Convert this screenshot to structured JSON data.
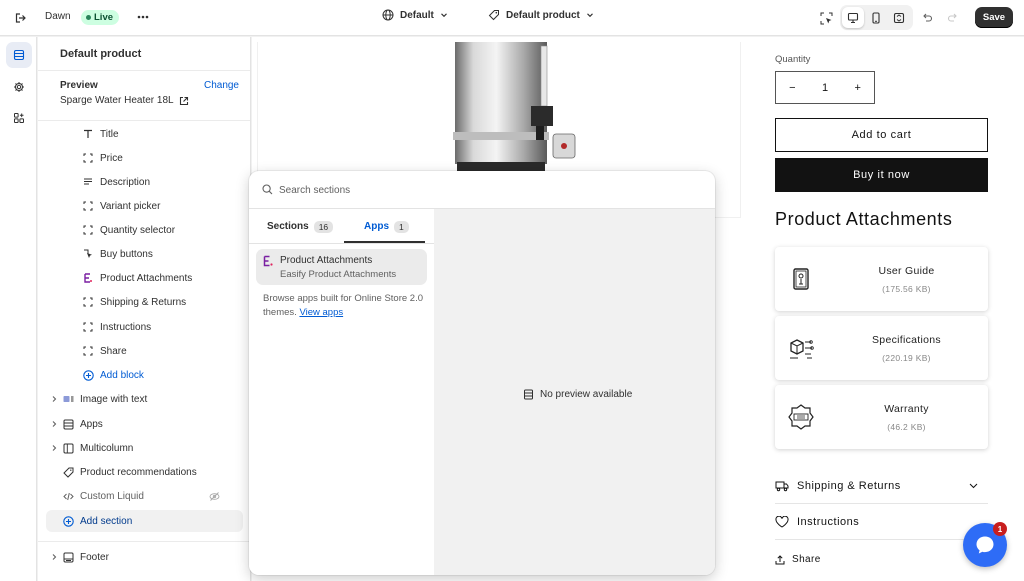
{
  "topbar": {
    "store_name": "Dawn",
    "live_badge": "Live",
    "theme_selector": "Default",
    "template_selector": "Default product",
    "save_label": "Save"
  },
  "sidebar": {
    "title": "Default product",
    "preview_label": "Preview",
    "preview_change": "Change",
    "preview_product": "Sparge Water Heater 18L",
    "blocks": [
      {
        "label": "Title",
        "icon": "title-icon"
      },
      {
        "label": "Price",
        "icon": "dashed-block-icon"
      },
      {
        "label": "Description",
        "icon": "text-lines-icon"
      },
      {
        "label": "Variant picker",
        "icon": "dashed-block-icon"
      },
      {
        "label": "Quantity selector",
        "icon": "dashed-block-icon"
      },
      {
        "label": "Buy buttons",
        "icon": "buy-buttons-icon"
      },
      {
        "label": "Product Attachments",
        "icon": "app-block-icon"
      },
      {
        "label": "Shipping & Returns",
        "icon": "dashed-block-icon"
      },
      {
        "label": "Instructions",
        "icon": "dashed-block-icon"
      },
      {
        "label": "Share",
        "icon": "dashed-block-icon"
      }
    ],
    "add_block": "Add block",
    "sections": [
      {
        "label": "Image with text",
        "icon": "image-text-icon"
      },
      {
        "label": "Apps",
        "icon": "apps-section-icon"
      },
      {
        "label": "Multicolumn",
        "icon": "multicolumn-icon"
      },
      {
        "label": "Product recommendations",
        "icon": "tag-icon"
      },
      {
        "label": "Custom Liquid",
        "icon": "code-icon"
      }
    ],
    "add_section": "Add section",
    "footer": "Footer"
  },
  "popover": {
    "search_placeholder": "Search sections",
    "tabs": [
      {
        "label": "Sections",
        "count": "16"
      },
      {
        "label": "Apps",
        "count": "1"
      }
    ],
    "app": {
      "name": "Product Attachments",
      "subtitle": "Easify Product Attachments"
    },
    "browse_text": "Browse apps built for Online Store 2.0 themes.",
    "view_apps": "View apps",
    "no_preview": "No preview available"
  },
  "preview": {
    "quantity_label": "Quantity",
    "quantity_value": "1",
    "minus": "−",
    "plus": "+",
    "add_to_cart": "Add to cart",
    "buy_now": "Buy it now",
    "attachments_heading": "Product Attachments",
    "attachments": [
      {
        "name": "User Guide",
        "size": "(175.56 KB)",
        "icon": "user-guide-icon"
      },
      {
        "name": "Specifications",
        "size": "(220.19 KB)",
        "icon": "specifications-icon"
      },
      {
        "name": "Warranty",
        "size": "(46.2 KB)",
        "icon": "warranty-icon"
      }
    ],
    "shipping_returns": "Shipping & Returns",
    "instructions": "Instructions",
    "share": "Share",
    "chat_badge": "1"
  },
  "colors": {
    "accent": "#005bd3",
    "live_badge_bg": "#cdfee1",
    "save_button": "#303030",
    "chat_button": "#2e6cf6"
  }
}
